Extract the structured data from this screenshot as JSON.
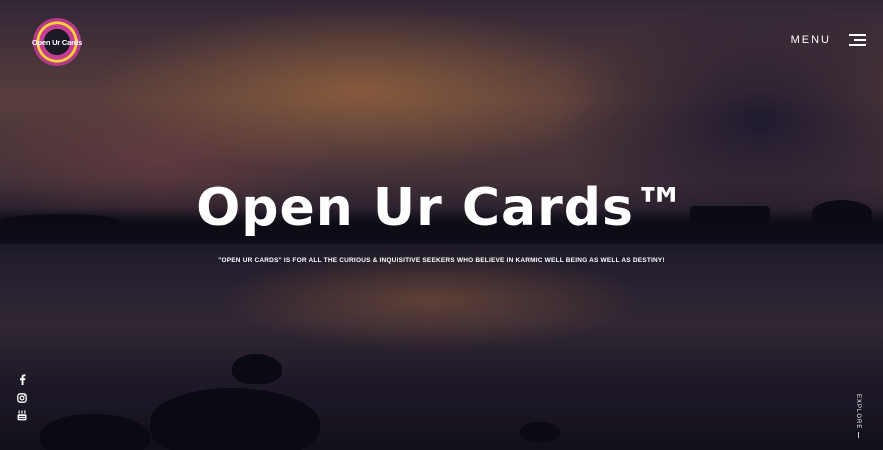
{
  "logo": {
    "text": "Open Ur Cards"
  },
  "nav": {
    "menu_label": "MENU",
    "menu_icon": "hamburger-icon"
  },
  "hero": {
    "title": "Open Ur Cards™",
    "tagline": "\"OPEN UR CARDS\" IS FOR ALL THE CURIOUS & INQUISITIVE SEEKERS WHO BELIEVE IN KARMIC WELL BEING AS WELL AS DESTINY!"
  },
  "social": [
    {
      "icon": "facebook-icon"
    },
    {
      "icon": "instagram-icon"
    },
    {
      "icon": "youtube-icon"
    }
  ],
  "scroll": {
    "label": "EXPLORE"
  },
  "colors": {
    "logo_ring": "#c43e93",
    "logo_accent": "#ffd23a",
    "text": "#ffffff"
  }
}
